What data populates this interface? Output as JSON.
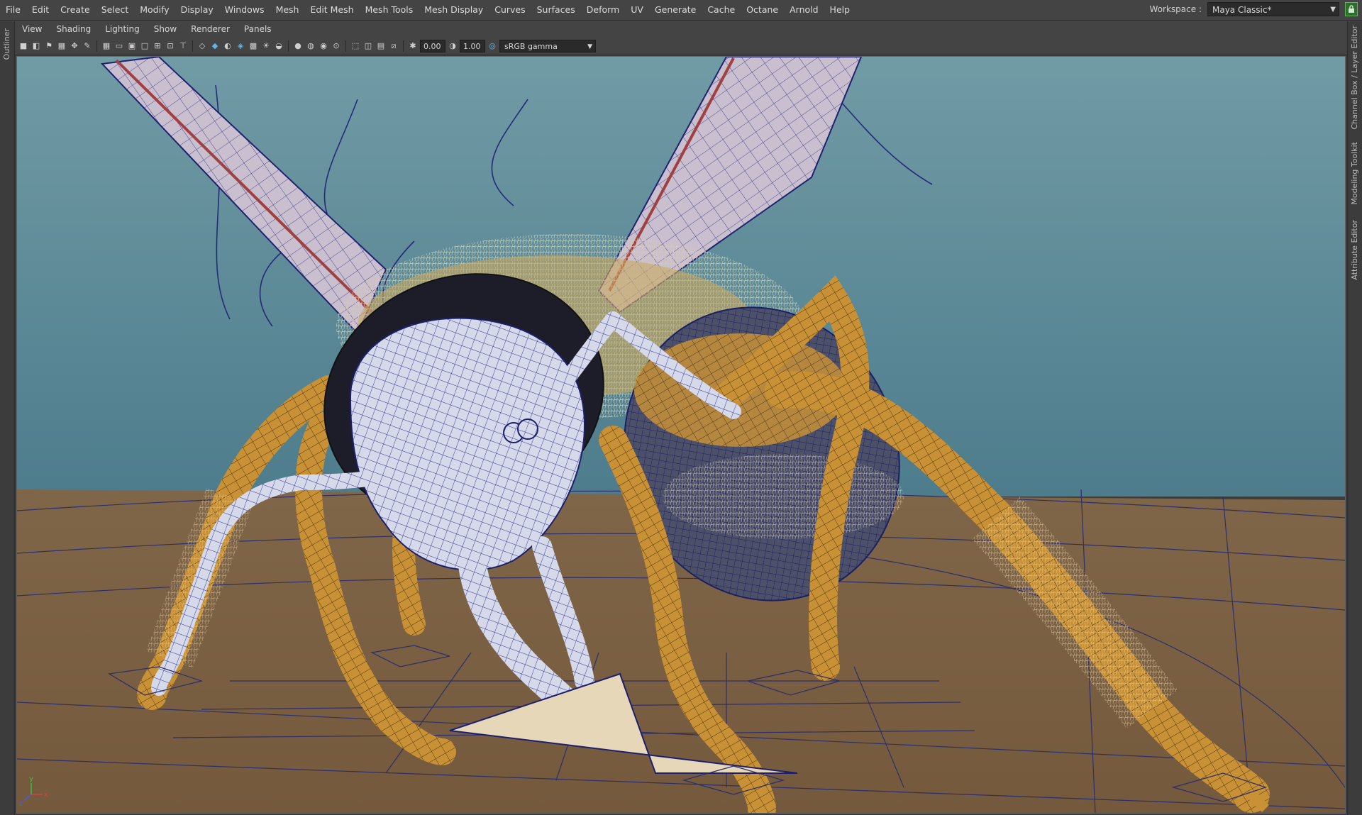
{
  "main_menu": {
    "items": [
      "File",
      "Edit",
      "Create",
      "Select",
      "Modify",
      "Display",
      "Windows",
      "Mesh",
      "Edit Mesh",
      "Mesh Tools",
      "Mesh Display",
      "Curves",
      "Surfaces",
      "Deform",
      "UV",
      "Generate",
      "Cache",
      "Octane",
      "Arnold",
      "Help"
    ]
  },
  "workspace": {
    "label": "Workspace :",
    "value": "Maya Classic*"
  },
  "left_tabs": {
    "outliner": "Outliner"
  },
  "right_tabs": {
    "channel_box": "Channel Box / Layer Editor",
    "modeling_toolkit": "Modeling Toolkit",
    "attribute_editor": "Attribute Editor"
  },
  "panel_menu": {
    "items": [
      "View",
      "Shading",
      "Lighting",
      "Show",
      "Renderer",
      "Panels"
    ]
  },
  "toolbar": {
    "exposure": "0.00",
    "gamma": "1.00",
    "color_space": "sRGB gamma"
  },
  "colors": {
    "sky_top": "#6f98a3",
    "sky_bottom": "#4f7e8e",
    "floor": "#7d6446",
    "wire": "#1c1f6e",
    "leg_fill": "#c9933a",
    "head_fill": "#d4d8ea",
    "fur": "#d8c28f"
  },
  "axis_labels": {
    "x": "x",
    "y": "y",
    "z": "z"
  }
}
